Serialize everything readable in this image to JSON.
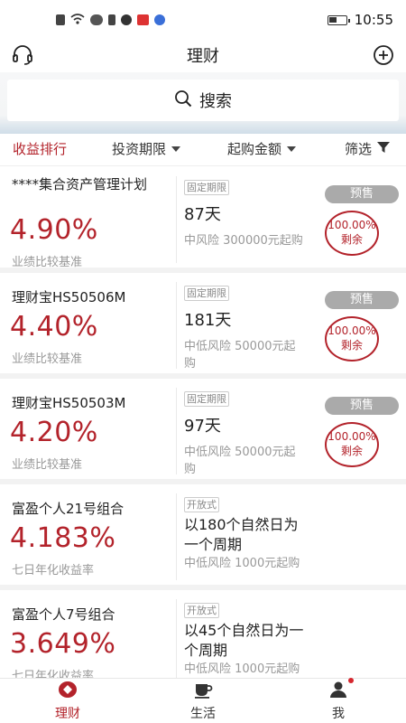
{
  "statusbar": {
    "time": "10:55",
    "icons": [
      "notification-icon",
      "wifi-icon",
      "huawei-icon",
      "phone-icon",
      "app-icon",
      "book-icon",
      "music-icon",
      "battery-icon"
    ]
  },
  "header": {
    "title": "理财",
    "left_icon": "headset-icon",
    "right_icon": "plus-circle-icon"
  },
  "search": {
    "label": "搜索",
    "icon": "search-icon"
  },
  "filters": [
    {
      "label": "收益排行",
      "active": true
    },
    {
      "label": "投资期限",
      "has_dropdown": true
    },
    {
      "label": "起购金额",
      "has_dropdown": true
    },
    {
      "label": "筛选",
      "icon": "filter-icon"
    }
  ],
  "products": [
    {
      "name": "****集合资产管理计划",
      "rate": "4.90%",
      "rate_label": "业绩比较基准",
      "tag": "固定期限",
      "term": "87天",
      "risk": "中风险 300000元起购",
      "presale": "预售",
      "remain_pct": "100.00%",
      "remain_label": "剩余"
    },
    {
      "name": "理财宝HS50506M",
      "rate": "4.40%",
      "rate_label": "业绩比较基准",
      "tag": "固定期限",
      "term": "181天",
      "risk": "中低风险 50000元起购",
      "presale": "预售",
      "remain_pct": "100.00%",
      "remain_label": "剩余"
    },
    {
      "name": "理财宝HS50503M",
      "rate": "4.20%",
      "rate_label": "业绩比较基准",
      "tag": "固定期限",
      "term": "97天",
      "risk": "中低风险 50000元起购",
      "presale": "预售",
      "remain_pct": "100.00%",
      "remain_label": "剩余"
    },
    {
      "name": "富盈个人21号组合",
      "rate": "4.183%",
      "rate_label": "七日年化收益率",
      "tag": "开放式",
      "term": "以180个自然日为一个周期",
      "risk": "中低风险 1000元起购"
    },
    {
      "name": "富盈个人7号组合",
      "rate": "3.649%",
      "rate_label": "七日年化收益率",
      "tag": "开放式",
      "term": "以45个自然日为一个周期",
      "risk": "中低风险 1000元起购"
    }
  ],
  "tabbar": [
    {
      "label": "理财",
      "icon": "finance-icon",
      "active": true
    },
    {
      "label": "生活",
      "icon": "coffee-icon"
    },
    {
      "label": "我",
      "icon": "user-icon",
      "badge": true
    }
  ],
  "colors": {
    "accent": "#b3232b",
    "muted": "#999999",
    "presale_bg": "#aaaaaa"
  }
}
